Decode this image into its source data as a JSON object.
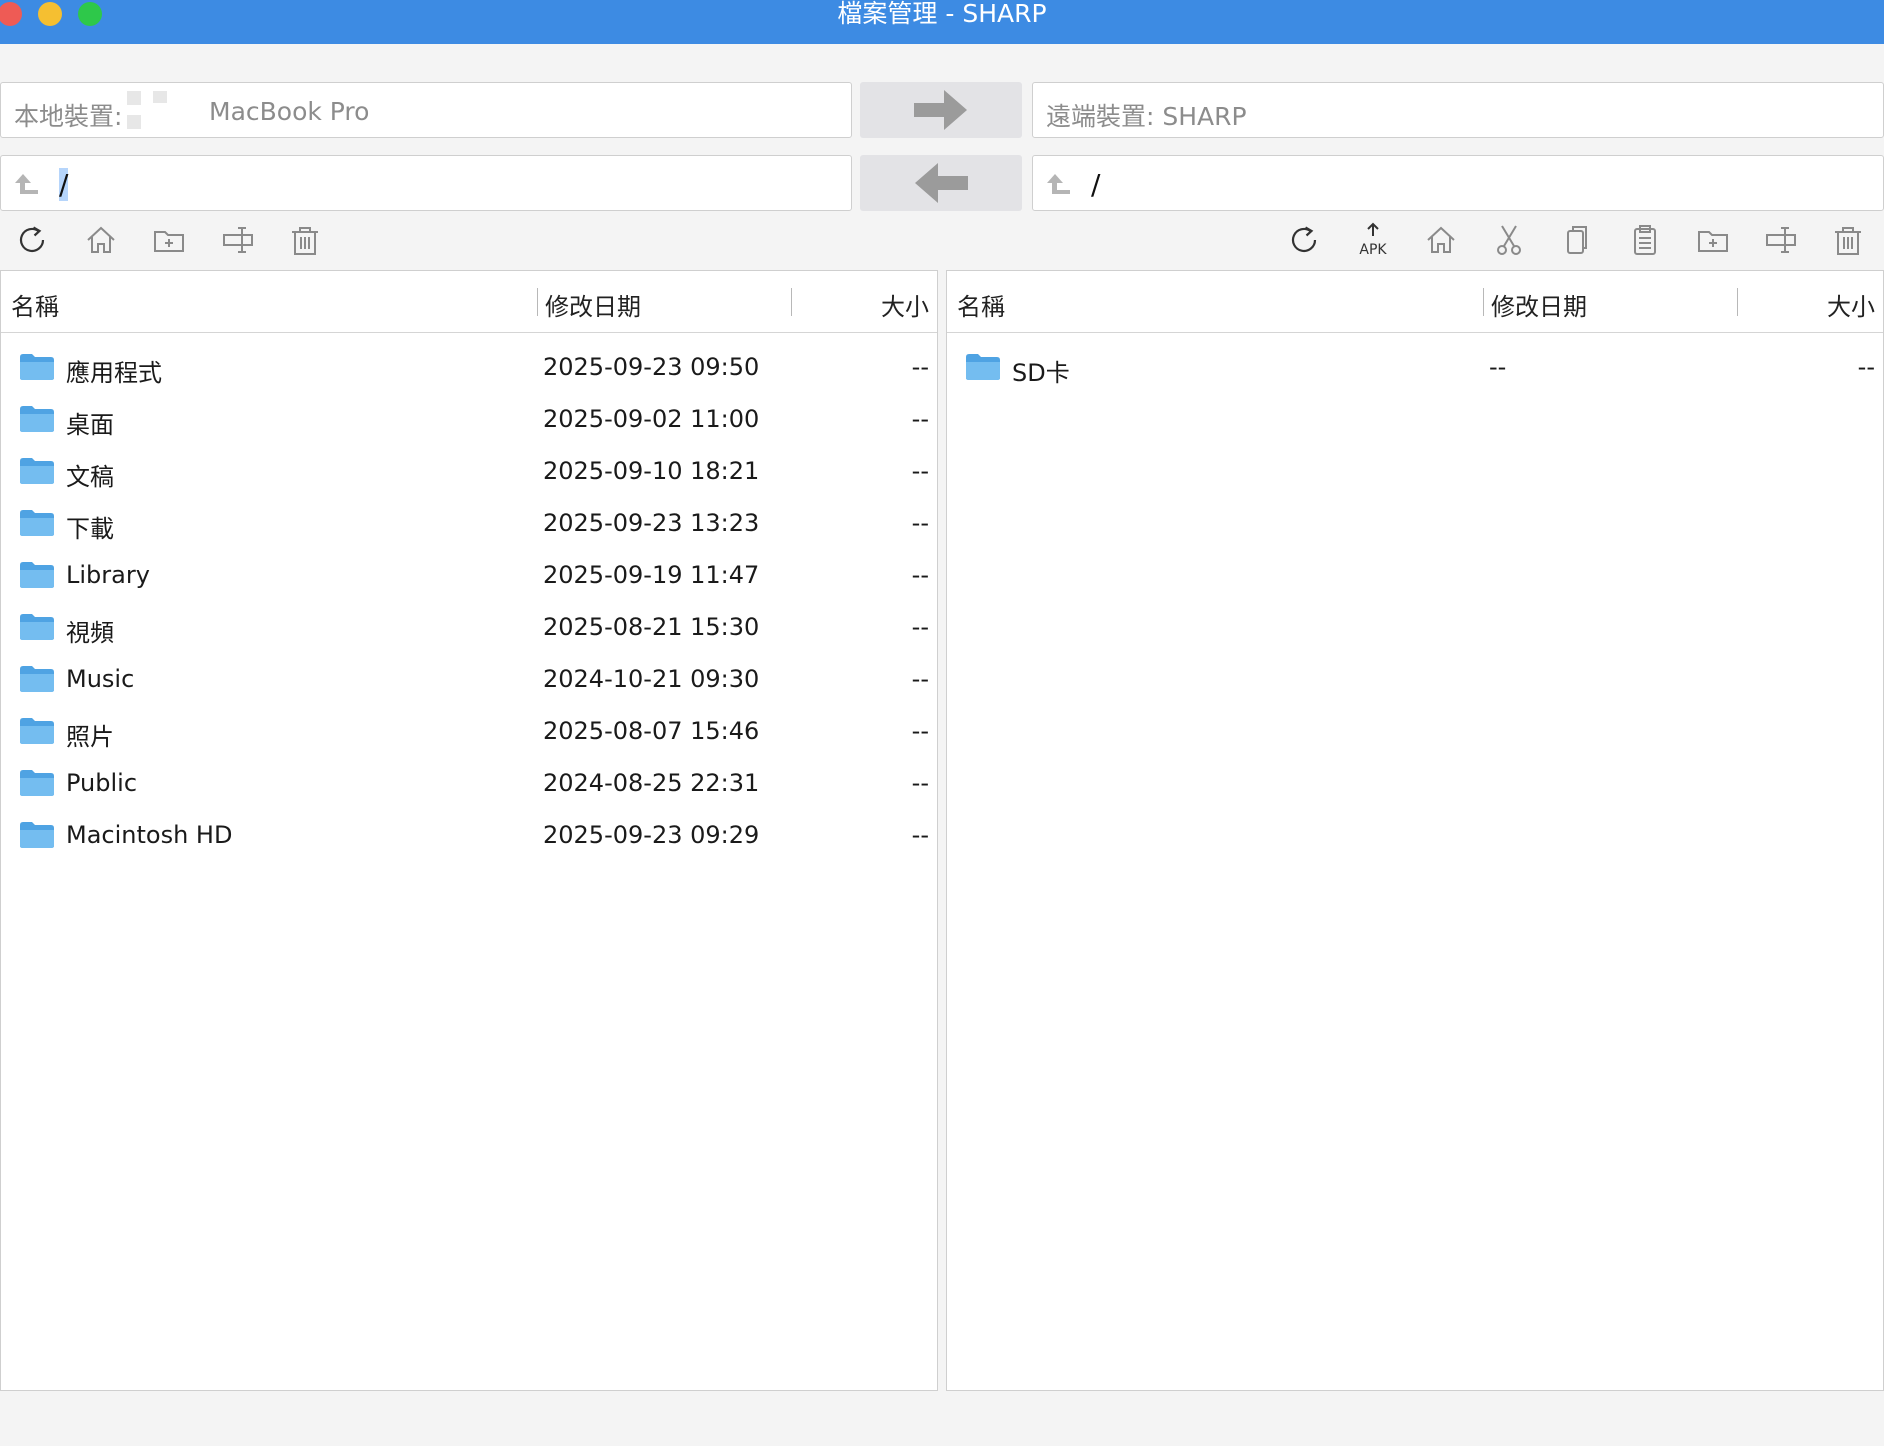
{
  "window": {
    "title": "檔案管理 - SHARP"
  },
  "local": {
    "device_label": "本地裝置:",
    "device_name": "MacBook Pro",
    "path": "/",
    "columns": {
      "name": "名稱",
      "date": "修改日期",
      "size": "大小"
    },
    "files": [
      {
        "name": "應用程式",
        "date": "2025-09-23 09:50",
        "size": "--"
      },
      {
        "name": "桌面",
        "date": "2025-09-02 11:00",
        "size": "--"
      },
      {
        "name": "文稿",
        "date": "2025-09-10 18:21",
        "size": "--"
      },
      {
        "name": "下載",
        "date": "2025-09-23 13:23",
        "size": "--"
      },
      {
        "name": "Library",
        "date": "2025-09-19 11:47",
        "size": "--"
      },
      {
        "name": "視頻",
        "date": "2025-08-21 15:30",
        "size": "--"
      },
      {
        "name": "Music",
        "date": "2024-10-21 09:30",
        "size": "--"
      },
      {
        "name": "照片",
        "date": "2025-08-07 15:46",
        "size": "--"
      },
      {
        "name": "Public",
        "date": "2024-08-25 22:31",
        "size": "--"
      },
      {
        "name": "Macintosh HD",
        "date": "2025-09-23 09:29",
        "size": "--"
      }
    ]
  },
  "remote": {
    "device_label": "遠端裝置: SHARP",
    "path": "/",
    "columns": {
      "name": "名稱",
      "date": "修改日期",
      "size": "大小"
    },
    "files": [
      {
        "name": "SD卡",
        "date": "--",
        "size": "--"
      }
    ]
  },
  "toolbar": {
    "apk_label": "APK",
    "left_icons": [
      "refresh-icon",
      "home-icon",
      "new-folder-icon",
      "rename-icon",
      "trash-icon"
    ],
    "right_icons": [
      "refresh-icon",
      "apk-install-icon",
      "home-icon",
      "cut-icon",
      "copy-icon",
      "paste-icon",
      "new-folder-icon",
      "rename-icon",
      "trash-icon"
    ]
  },
  "colors": {
    "titlebar": "#3d8be3",
    "folder": "#6cb5ea",
    "icon": "#8a8a8a",
    "selection": "#b6d5fb"
  }
}
